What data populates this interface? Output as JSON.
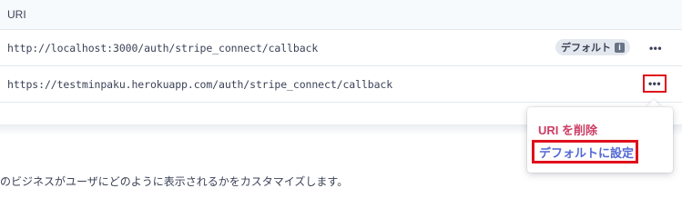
{
  "table": {
    "header": "URI",
    "rows": [
      {
        "uri": "http://localhost:3000/auth/stripe_connect/callback",
        "badge": "デフォルト",
        "badge_icon": "info-icon",
        "more": "•••"
      },
      {
        "uri": "https://testminpaku.herokuapp.com/auth/stripe_connect/callback",
        "more": "•••"
      }
    ]
  },
  "menu": {
    "delete_label": "URI を削除",
    "set_default_label": "デフォルトに設定"
  },
  "description": "のビジネスがユーザにどのように表示されるかをカスタマイズします。",
  "colors": {
    "danger": "#cd3d64",
    "link": "#5469d4",
    "highlight": "#e0101b"
  }
}
